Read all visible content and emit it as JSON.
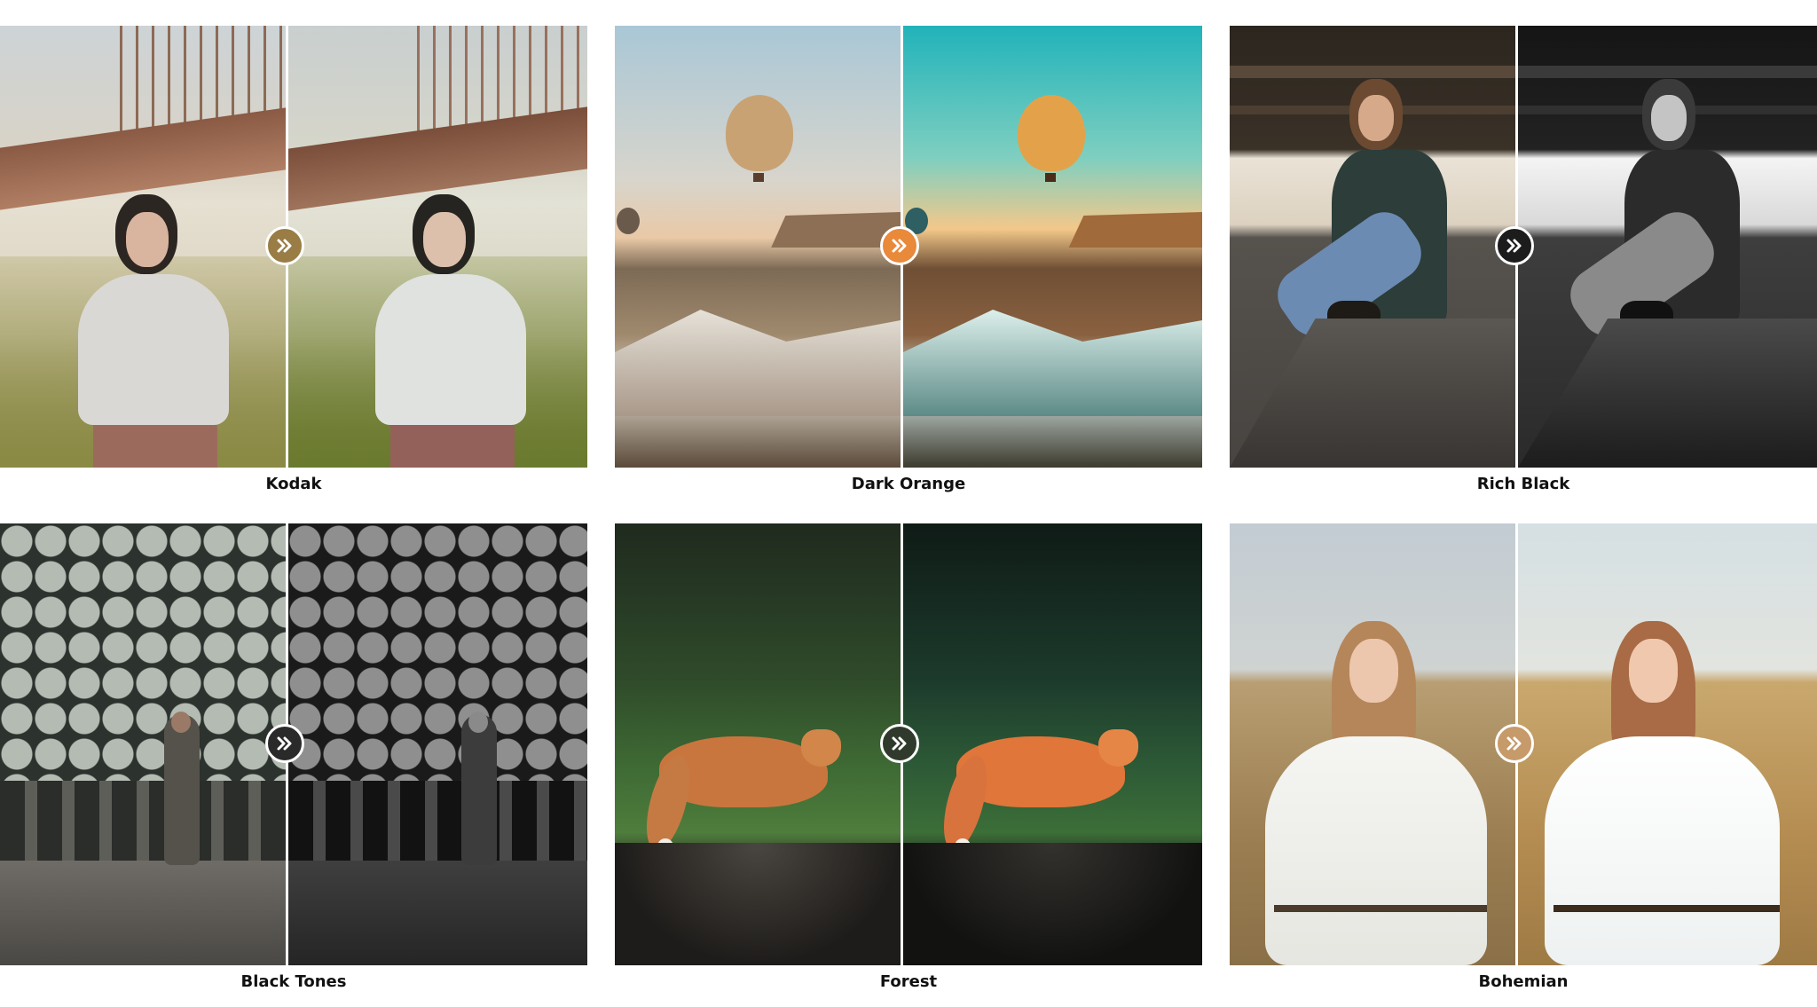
{
  "presets": [
    {
      "name": "Kodak",
      "arrow_color": "#9a7c45"
    },
    {
      "name": "Dark Orange",
      "arrow_color": "#e9893a"
    },
    {
      "name": "Rich Black",
      "arrow_color": "#1c1c1c"
    },
    {
      "name": "Black Tones",
      "arrow_color": "#2a2a2a"
    },
    {
      "name": "Forest",
      "arrow_color": "#2f3a2c"
    },
    {
      "name": "Bohemian",
      "arrow_color": "#c79a6a"
    }
  ],
  "arrow_icon": "double-chevron-right-icon"
}
